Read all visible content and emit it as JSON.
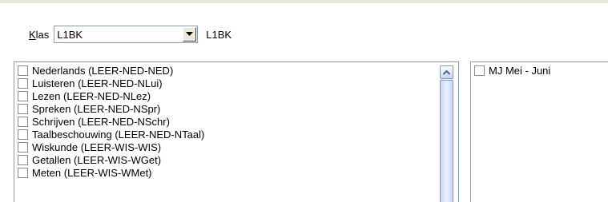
{
  "klas": {
    "label_access_key": "K",
    "label_rest": "las",
    "selected_value": "L1BK",
    "code_display": "L1BK"
  },
  "icons": {
    "combo_dropdown": "chevron-down-icon",
    "scroll_up": "chevron-up-icon"
  },
  "colors": {
    "border": "#7f9db9",
    "scroll_accent": "#4d6185"
  },
  "subjects": [
    "Nederlands (LEER-NED-NED)",
    "Luisteren (LEER-NED-NLui)",
    "Lezen (LEER-NED-NLez)",
    "Spreken (LEER-NED-NSpr)",
    "Schrijven (LEER-NED-NSchr)",
    "Taalbeschouwing (LEER-NED-NTaal)",
    "Wiskunde (LEER-WIS-WIS)",
    "Getallen (LEER-WIS-WGet)",
    "Meten (LEER-WIS-WMet)"
  ],
  "periods": [
    "MJ Mei - Juni"
  ]
}
